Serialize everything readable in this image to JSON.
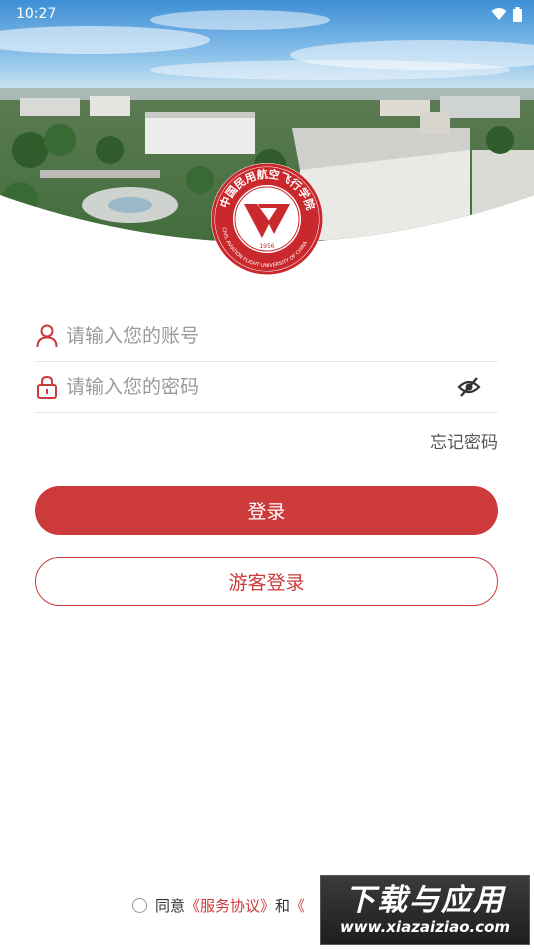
{
  "status_bar": {
    "time": "10:27",
    "battery_icon": "battery-icon",
    "wifi_icon": "wifi-icon"
  },
  "brand": {
    "accent_color": "#cd3a3b",
    "logo_text": "中国民用航空飞行学院",
    "logo_subtext": "CIVIL AVIATION FLIGHT UNIVERSITY OF CHINA",
    "logo_year": "1956"
  },
  "form": {
    "account": {
      "placeholder": "请输入您的账号",
      "value": "",
      "icon": "user-icon"
    },
    "password": {
      "placeholder": "请输入您的密码",
      "value": "",
      "icon": "lock-icon",
      "toggle_icon": "eye-off-icon"
    },
    "forgot_label": "忘记密码",
    "login_label": "登录",
    "guest_label": "游客登录"
  },
  "agreement": {
    "prefix": "同意",
    "service_link": "《服务协议》",
    "conjunction": "和",
    "privacy_link": "《"
  },
  "watermark": {
    "title": "下载与应用",
    "url": "www.xiazaiziao.com"
  }
}
